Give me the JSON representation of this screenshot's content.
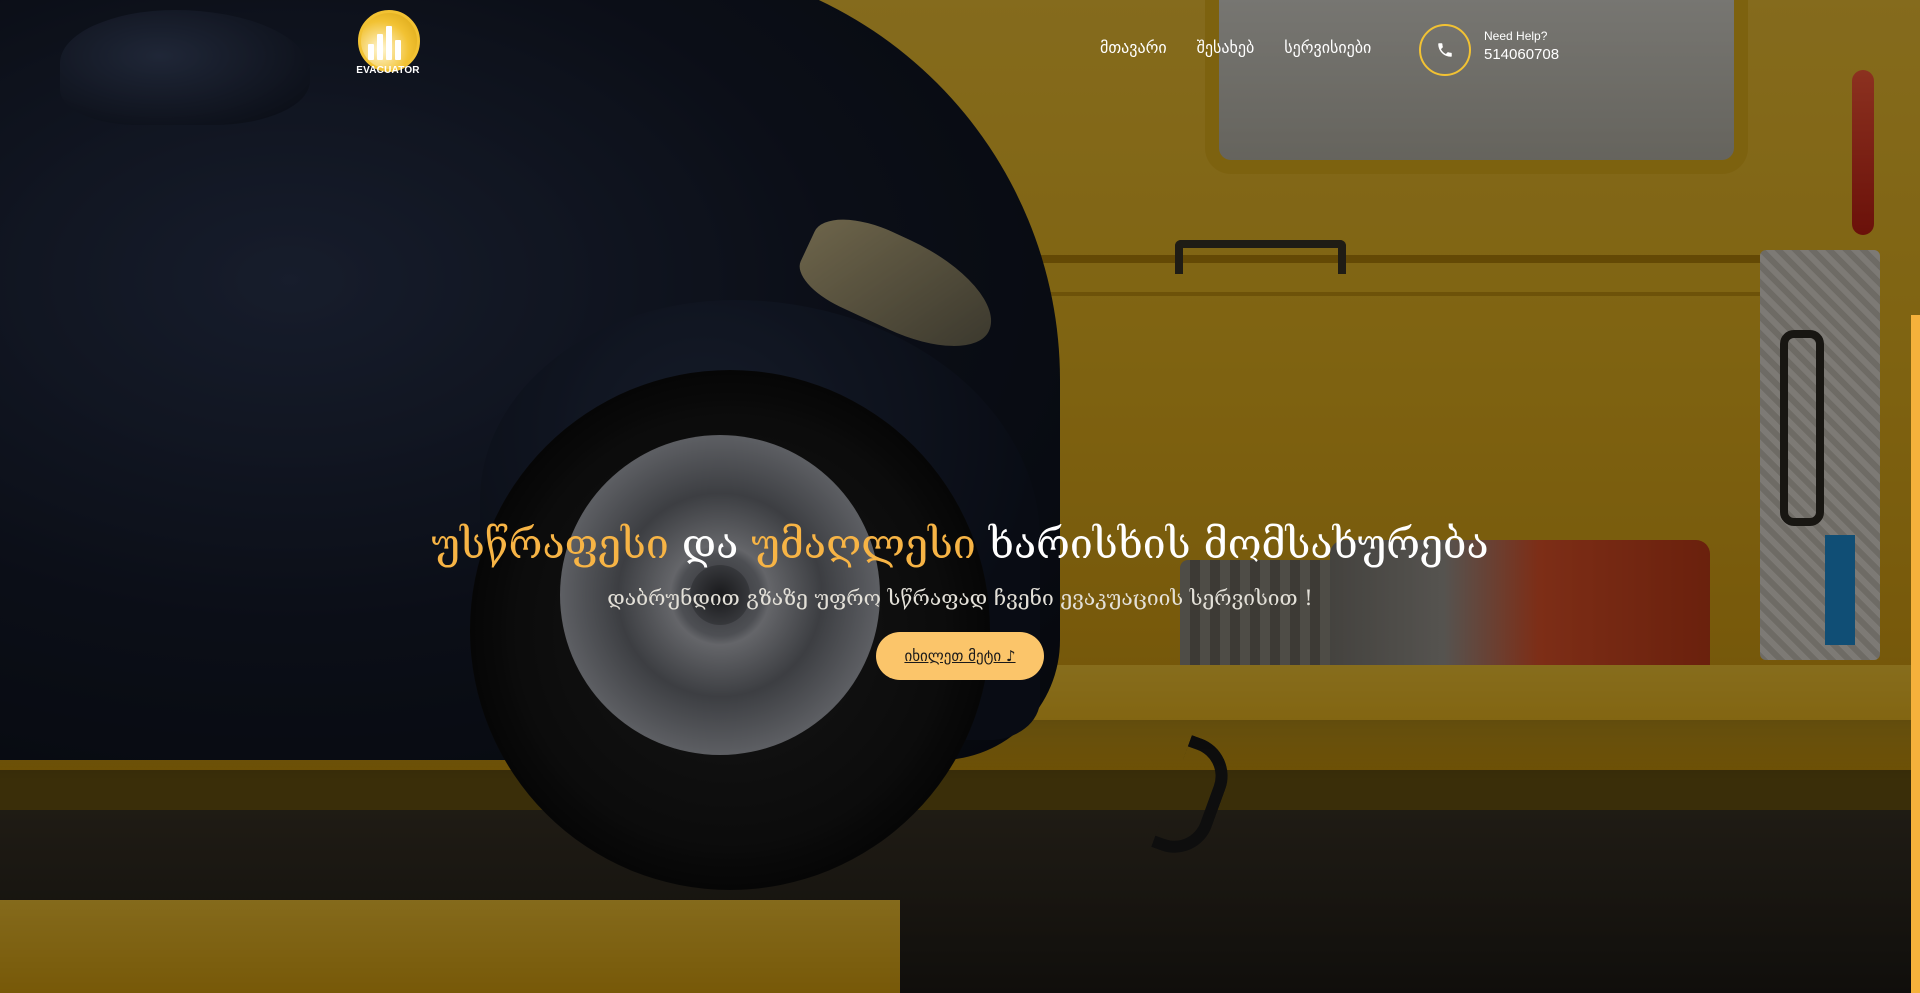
{
  "header": {
    "logo_text": "EVACUATOR",
    "nav": [
      {
        "label": "მთავარი"
      },
      {
        "label": "შესახებ"
      },
      {
        "label": "სერვისიები"
      }
    ],
    "phone_icon": "phone-icon",
    "help_label": "Need Help?",
    "help_number": "514060708"
  },
  "hero": {
    "title_part1": "უსწრაფესი",
    "title_part2": "და",
    "title_part3": "უმაღლესი",
    "title_part4": "ხარისხის მომსახურება",
    "subtitle": "დაბრუნდით გზაზე უფრო სწრაფად ჩვენი ევაკუაციის სერვისით !",
    "cta_label": "იხილეთ მეტი ♪"
  },
  "colors": {
    "accent": "#f7b445",
    "cta_background": "#fbc56a",
    "logo_yellow": "#f2c233",
    "scrollbar": "#f5b13b"
  }
}
